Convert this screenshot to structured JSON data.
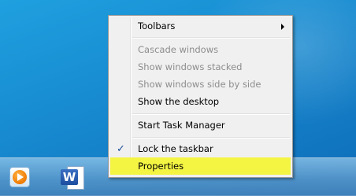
{
  "context_menu": {
    "items": [
      {
        "label": "Toolbars",
        "has_submenu": true
      },
      {
        "label": "Cascade windows",
        "disabled": true
      },
      {
        "label": "Show windows stacked",
        "disabled": true
      },
      {
        "label": "Show windows side by side",
        "disabled": true
      },
      {
        "label": "Show the desktop"
      },
      {
        "label": "Start Task Manager"
      },
      {
        "label": "Lock the taskbar",
        "checked": true,
        "check_glyph": "✓"
      },
      {
        "label": "Properties",
        "highlighted": true
      }
    ],
    "highlight_color": "#f4f443"
  },
  "taskbar": {
    "pinned_apps": [
      {
        "name": "windows-media-player",
        "icon": "media-player-icon"
      },
      {
        "name": "microsoft-word",
        "icon": "word-icon",
        "badge_text": "W"
      }
    ]
  },
  "desktop": {
    "background_color": "#1789cf"
  }
}
